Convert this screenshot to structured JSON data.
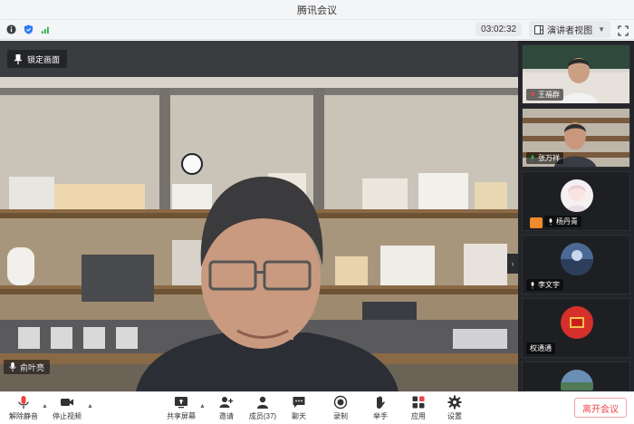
{
  "window": {
    "title": "腾讯会议"
  },
  "infobar": {
    "timer": "03:02:32",
    "view_label": "演讲者视图"
  },
  "stage": {
    "pin_label": "锁定画面",
    "speaker_name": "俞叶亮"
  },
  "participants": [
    {
      "name": "王福群",
      "type": "video"
    },
    {
      "name": "张万祥",
      "type": "video"
    },
    {
      "name": "杨丹青",
      "type": "avatar"
    },
    {
      "name": "李文宇",
      "type": "avatar"
    },
    {
      "name": "权通通",
      "type": "avatar"
    },
    {
      "name": "",
      "type": "avatar"
    }
  ],
  "toolbar": {
    "mute": "解除静音",
    "stop_video": "停止视频",
    "share": "共享屏幕",
    "invite": "邀请",
    "members": "成员(37)",
    "chat": "聊天",
    "record": "录制",
    "raise_hand": "举手",
    "apps": "应用",
    "settings": "设置",
    "leave": "离开会议"
  },
  "colors": {
    "accent": "#2b7cf7",
    "leave": "#e44444",
    "mic_muted": "#e44444"
  }
}
